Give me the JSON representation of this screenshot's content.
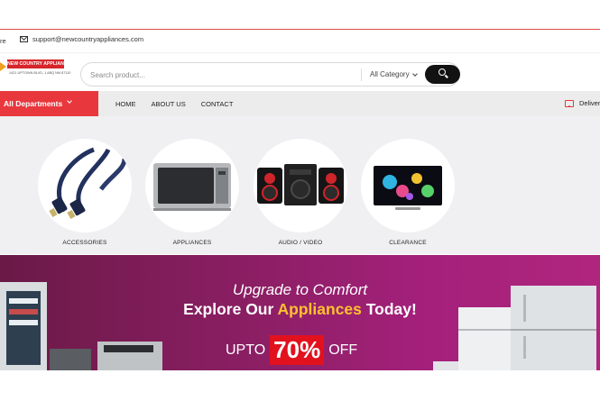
{
  "topbar": {
    "store_text": "re",
    "email": "support@newcountryappliances.com"
  },
  "logo": {
    "name": "NEW COUNTRY APPLIANCES",
    "tagline": "1421 UPTOWN BLVD, 1 ABQ NM 87110"
  },
  "search": {
    "placeholder": "Search product...",
    "category": "All Category"
  },
  "nav": {
    "departments": "All Departments",
    "links": [
      "HOME",
      "ABOUT US",
      "CONTACT"
    ],
    "delivery": "Deliver"
  },
  "categories": [
    {
      "label": "ACCESSORIES",
      "icon": "cable-image"
    },
    {
      "label": "APPLIANCES",
      "icon": "microwave-image"
    },
    {
      "label": "AUDIO / VIDEO",
      "icon": "stereo-image"
    },
    {
      "label": "CLEARANCE",
      "icon": "tv-image"
    }
  ],
  "hero": {
    "line1": "Upgrade to Comfort",
    "line2_pre": "Explore Our ",
    "line2_highlight": "Appliances",
    "line2_post": " Today!",
    "promo_pre": "UPTO",
    "promo_value": "70%",
    "promo_post": "OFF"
  },
  "colors": {
    "accent_red": "#e8383d",
    "highlight_yellow": "#ffc12e",
    "hero_purple": "#8e1f66"
  }
}
